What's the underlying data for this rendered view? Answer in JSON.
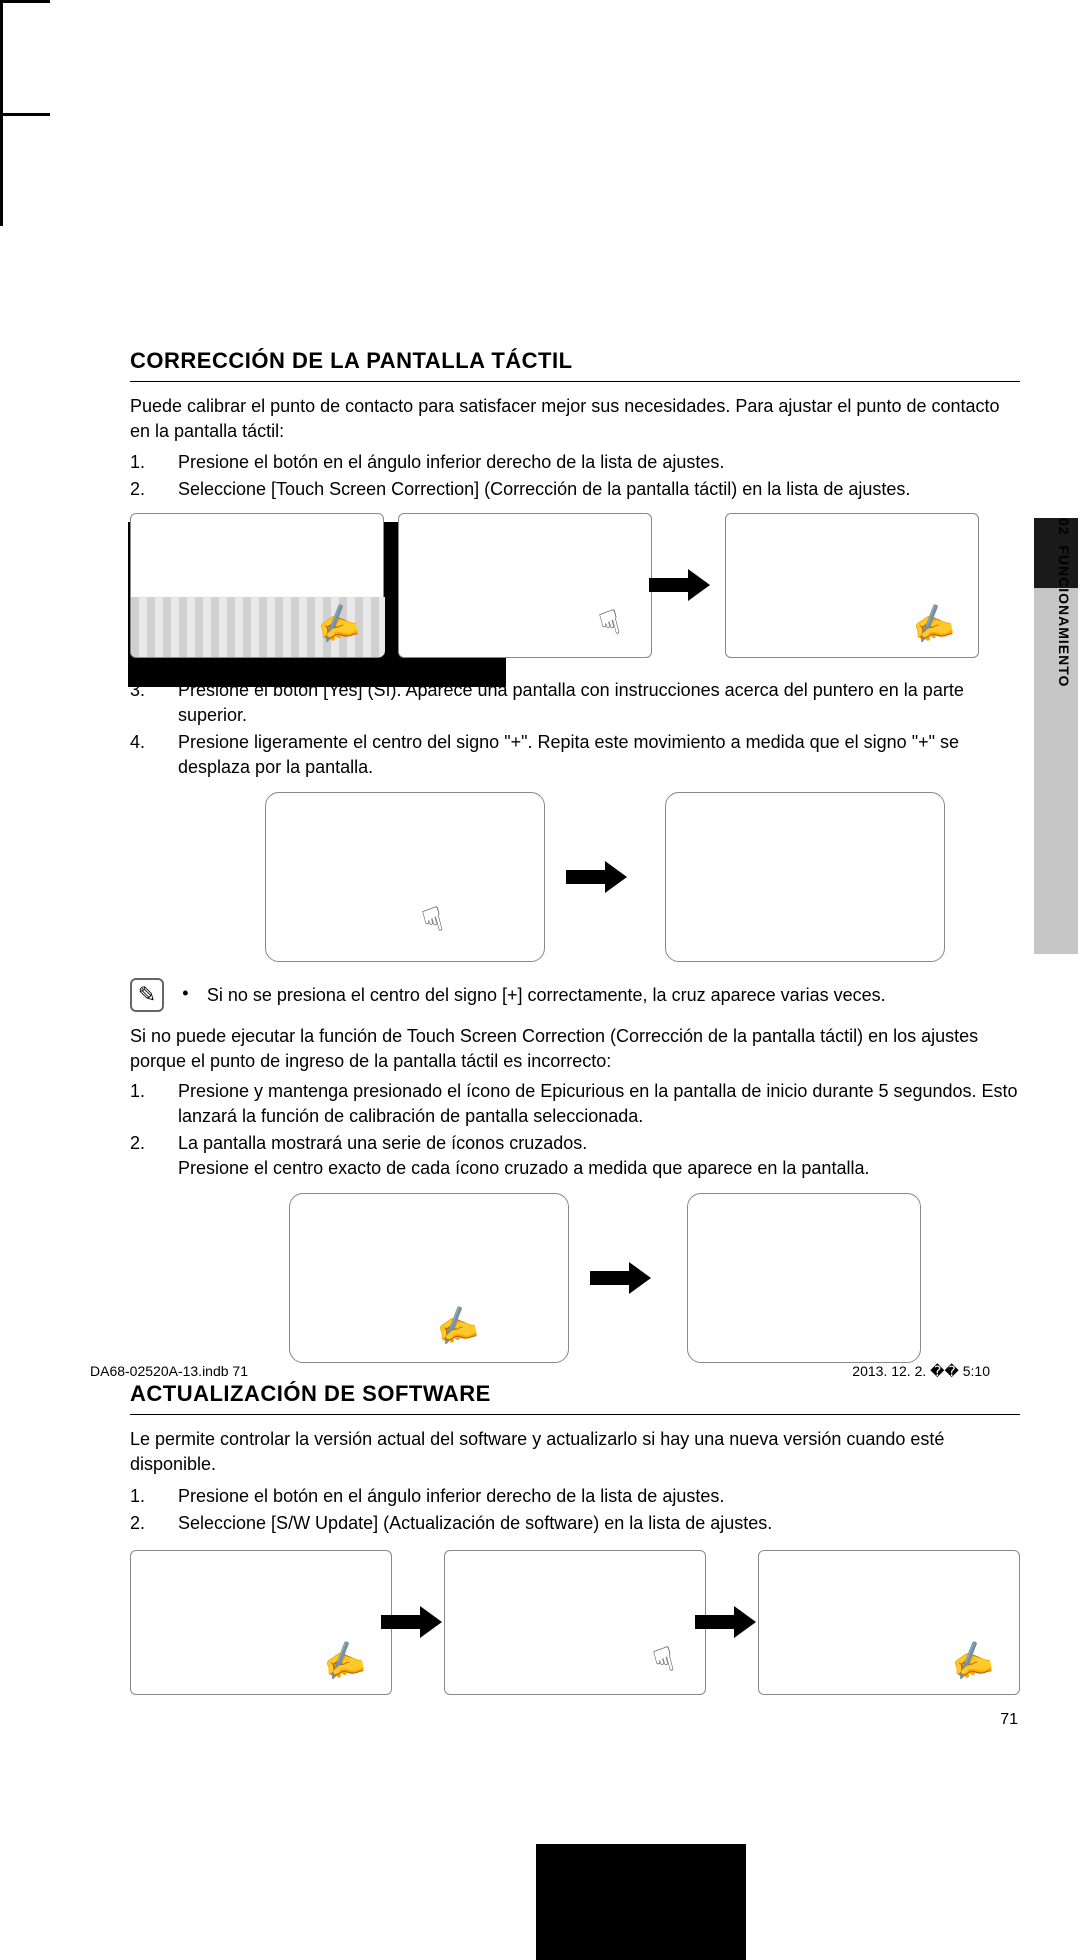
{
  "tab": {
    "chapter_num": "02",
    "chapter_title": "FUNCIONAMIENTO"
  },
  "section1": {
    "heading": "CORRECCIÓN DE LA PANTALLA TÁCTIL",
    "intro": "Puede calibrar el punto de contacto para satisfacer mejor sus necesidades. Para ajustar el punto de contacto en la pantalla táctil:",
    "steps_a": [
      {
        "num": "1.",
        "text": "Presione el botón        en el ángulo inferior derecho de la lista de ajustes."
      },
      {
        "num": "2.",
        "text": "Seleccione [Touch Screen Correction] (Corrección de la pantalla táctil) en la lista de ajustes."
      }
    ],
    "steps_b": [
      {
        "num": "3.",
        "text": "Presione el botón [Yes] (Sí). Aparece una pantalla con instrucciones acerca del puntero en la parte superior."
      },
      {
        "num": "4.",
        "text": "Presione ligeramente el centro del signo \"+\". Repita este movimiento a medida que el signo \"+\" se desplaza por la pantalla."
      }
    ],
    "note_bullet": "•",
    "note": "Si no se presiona el centro del signo [+] correctamente, la cruz aparece varias veces.",
    "followup": "Si no puede ejecutar la función de Touch Screen Correction (Corrección de la pantalla táctil) en los ajustes porque el punto de ingreso de la pantalla táctil es incorrecto:",
    "steps_c": [
      {
        "num": "1.",
        "text": "Presione y mantenga presionado el ícono de Epicurious en la pantalla de inicio durante 5 segundos. Esto lanzará la función de calibración de pantalla seleccionada."
      },
      {
        "num": "2.",
        "text": "La pantalla mostrará una serie de íconos cruzados.\nPresione el centro exacto de cada ícono cruzado a medida que aparece en la pantalla."
      }
    ]
  },
  "section2": {
    "heading": "ACTUALIZACIÓN DE SOFTWARE",
    "intro": "Le permite controlar la versión actual del software y actualizarlo si hay una nueva versión cuando esté disponible.",
    "steps": [
      {
        "num": "1.",
        "text": "Presione el botón        en el ángulo inferior derecho de la lista de ajustes."
      },
      {
        "num": "2.",
        "text": "Seleccione [S/W Update] (Actualización de software) en la lista de ajustes."
      }
    ]
  },
  "page_number": "71",
  "footer": {
    "left": "DA68-02520A-13.indb   71",
    "right": "2013. 12. 2.   �� 5:10"
  }
}
